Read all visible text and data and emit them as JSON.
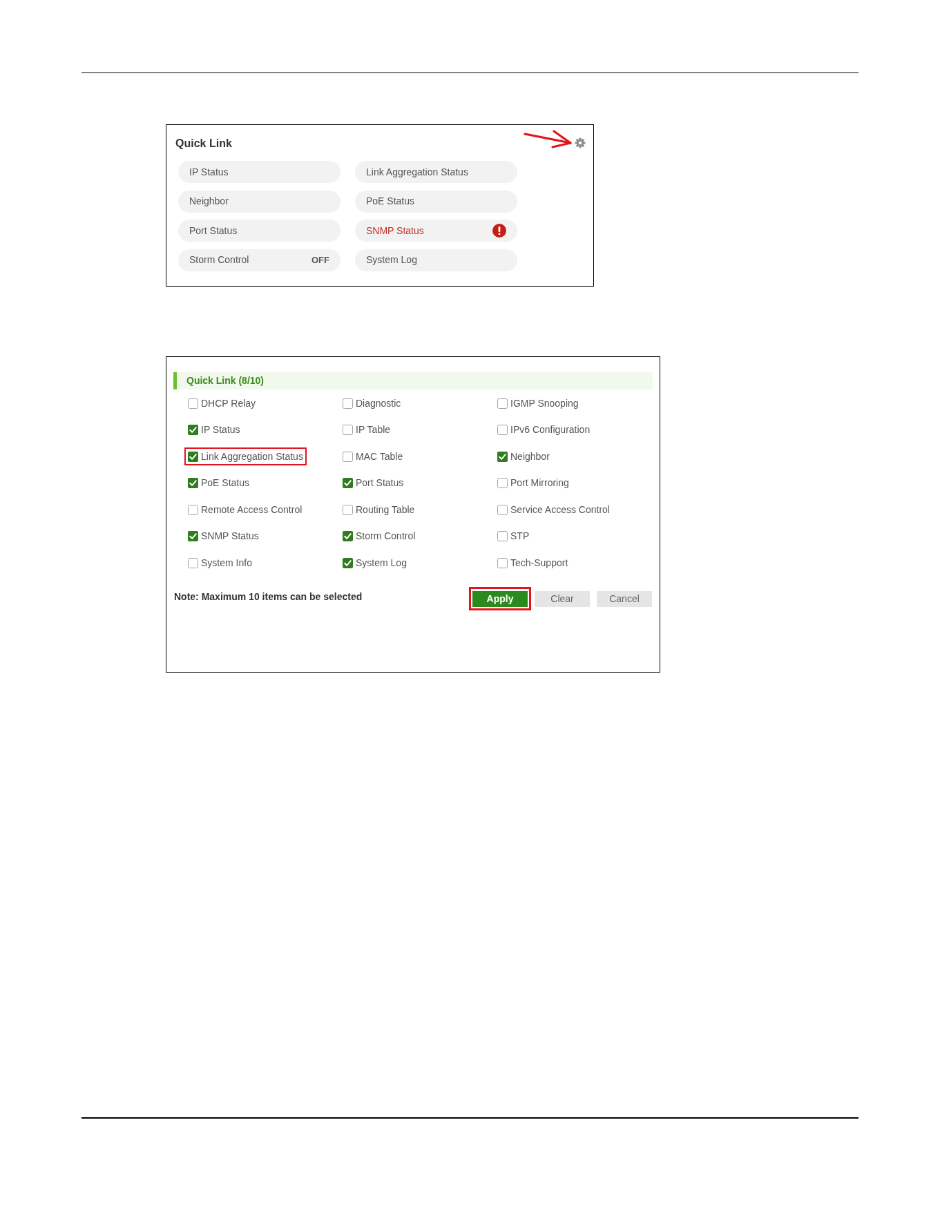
{
  "quick_link": {
    "title": "Quick Link",
    "settings": {
      "highlighted": true
    },
    "links": [
      {
        "label": "IP Status",
        "alert": false
      },
      {
        "label": "Link Aggregation Status",
        "alert": false
      },
      {
        "label": "Neighbor",
        "alert": false
      },
      {
        "label": "PoE Status",
        "alert": false
      },
      {
        "label": "Port Status",
        "alert": false
      },
      {
        "label": "SNMP Status",
        "alert": true
      },
      {
        "label": "Storm Control",
        "status": "OFF",
        "alert": false
      },
      {
        "label": "System Log",
        "alert": false
      }
    ]
  },
  "quick_link_settings": {
    "title": "Quick Link (8/10)",
    "options": [
      {
        "label": "DHCP Relay",
        "checked": false,
        "highlighted": false
      },
      {
        "label": "Diagnostic",
        "checked": false,
        "highlighted": false
      },
      {
        "label": "IGMP Snooping",
        "checked": false,
        "highlighted": false
      },
      {
        "label": "IP Status",
        "checked": true,
        "highlighted": false
      },
      {
        "label": "IP Table",
        "checked": false,
        "highlighted": false
      },
      {
        "label": "IPv6 Configuration",
        "checked": false,
        "highlighted": false
      },
      {
        "label": "Link Aggregation Status",
        "checked": true,
        "highlighted": true
      },
      {
        "label": "MAC Table",
        "checked": false,
        "highlighted": false
      },
      {
        "label": "Neighbor",
        "checked": true,
        "highlighted": false
      },
      {
        "label": "PoE Status",
        "checked": true,
        "highlighted": false
      },
      {
        "label": "Port Status",
        "checked": true,
        "highlighted": false
      },
      {
        "label": "Port Mirroring",
        "checked": false,
        "highlighted": false
      },
      {
        "label": "Remote Access Control",
        "checked": false,
        "highlighted": false
      },
      {
        "label": "Routing Table",
        "checked": false,
        "highlighted": false
      },
      {
        "label": "Service Access Control",
        "checked": false,
        "highlighted": false
      },
      {
        "label": "SNMP Status",
        "checked": true,
        "highlighted": false
      },
      {
        "label": "Storm Control",
        "checked": true,
        "highlighted": false
      },
      {
        "label": "STP",
        "checked": false,
        "highlighted": false
      },
      {
        "label": "System Info",
        "checked": false,
        "highlighted": false
      },
      {
        "label": "System Log",
        "checked": true,
        "highlighted": false
      },
      {
        "label": "Tech-Support",
        "checked": false,
        "highlighted": false
      }
    ],
    "note": "Note: Maximum 10 items can be selected",
    "buttons": [
      {
        "label": "Apply",
        "kind": "primary",
        "highlighted": true
      },
      {
        "label": "Clear",
        "kind": "secondary",
        "highlighted": false
      },
      {
        "label": "Cancel",
        "kind": "secondary",
        "highlighted": false
      }
    ]
  }
}
